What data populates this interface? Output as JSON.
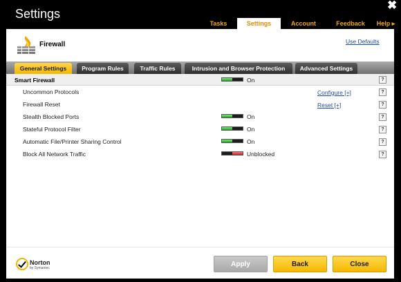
{
  "window": {
    "title": "Settings",
    "close_glyph": "✖"
  },
  "nav": {
    "tabs": [
      {
        "label": "Tasks"
      },
      {
        "label": "Settings"
      },
      {
        "label": "Account"
      },
      {
        "label": "Feedback"
      },
      {
        "label": "Help ▸"
      }
    ],
    "active": "Settings"
  },
  "header": {
    "title": "Firewall",
    "icon": "firewall-icon",
    "use_defaults": "Use Defaults"
  },
  "subtabs": [
    {
      "label": "General Settings"
    },
    {
      "label": "Program Rules"
    },
    {
      "label": "Traffic Rules"
    },
    {
      "label": "Intrusion and Browser Protection"
    },
    {
      "label": "Advanced Settings"
    }
  ],
  "settings": {
    "section": {
      "label": "Smart Firewall",
      "status": "On"
    },
    "rows": [
      {
        "label": "Uncommon Protocols",
        "link": "Configure [+]"
      },
      {
        "label": "Firewall Reset",
        "link": "Reset [+]"
      },
      {
        "label": "Stealth Blocked Ports",
        "status": "On"
      },
      {
        "label": "Stateful Protocol Filter",
        "status": "On"
      },
      {
        "label": "Automatic File/Printer Sharing Control",
        "status": "On"
      },
      {
        "label": "Block All Network Traffic",
        "status": "Unblocked"
      }
    ],
    "help_glyph": "?"
  },
  "brand": {
    "name": "Norton",
    "sub": "by Symantec"
  },
  "buttons": {
    "apply": "Apply",
    "back": "Back",
    "close": "Close"
  },
  "colors": {
    "accent": "#f2a900",
    "toggle_on": "#1ea51e",
    "toggle_off": "#c71f1f",
    "link": "#1a4b9c"
  }
}
